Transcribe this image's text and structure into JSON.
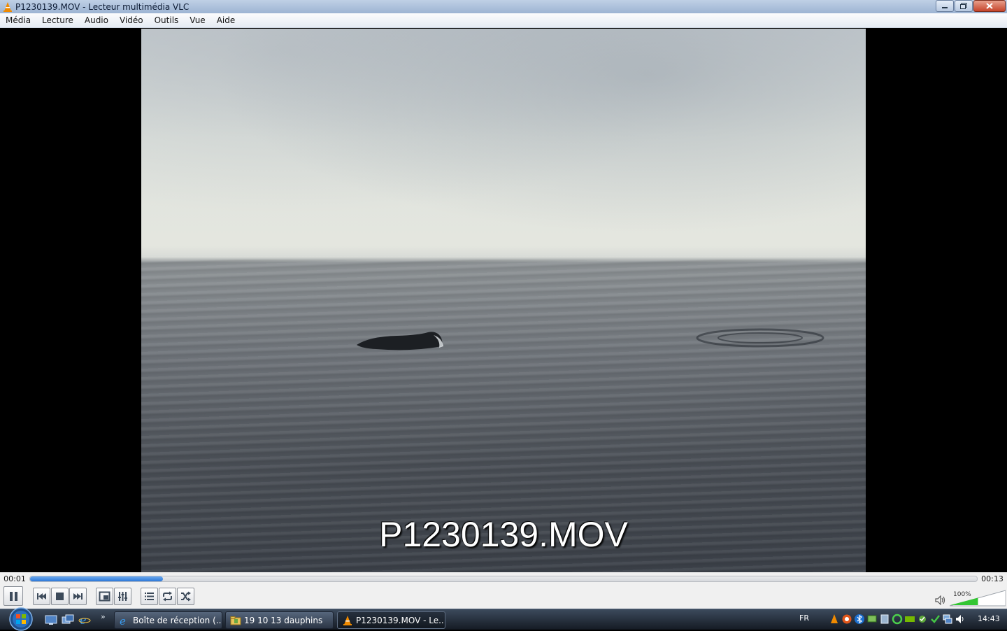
{
  "window": {
    "title": "P1230139.MOV - Lecteur multimédia VLC",
    "controls": [
      "minimize",
      "maximize",
      "close"
    ]
  },
  "menu": {
    "items": [
      "Média",
      "Lecture",
      "Audio",
      "Vidéo",
      "Outils",
      "Vue",
      "Aide"
    ]
  },
  "video": {
    "caption": "P1230139.MOV"
  },
  "seek": {
    "elapsed": "00:01",
    "total": "00:13",
    "progress_fraction": 0.14
  },
  "controls": {
    "buttons": [
      "pause",
      "previous",
      "stop",
      "next",
      "fullscreen",
      "extended-settings",
      "playlist",
      "loop",
      "random"
    ],
    "volume_label": "100%",
    "volume_fraction": 1.0
  },
  "taskbar": {
    "quick_launch": [
      "show-desktop",
      "switch-windows",
      "internet-explorer"
    ],
    "more": "»",
    "tasks": [
      {
        "label": "Boîte de réception (...",
        "icon": "internet-explorer-icon"
      },
      {
        "label": "19 10 13 dauphins",
        "icon": "folder-icon"
      },
      {
        "label": "P1230139.MOV - Le...",
        "icon": "vlc-icon",
        "active": true
      }
    ],
    "language": "FR",
    "clock": "14:43"
  },
  "colors": {
    "accent": "#2d78d8",
    "taskbar": "#1f2733",
    "vlc_orange": "#f08a00"
  }
}
